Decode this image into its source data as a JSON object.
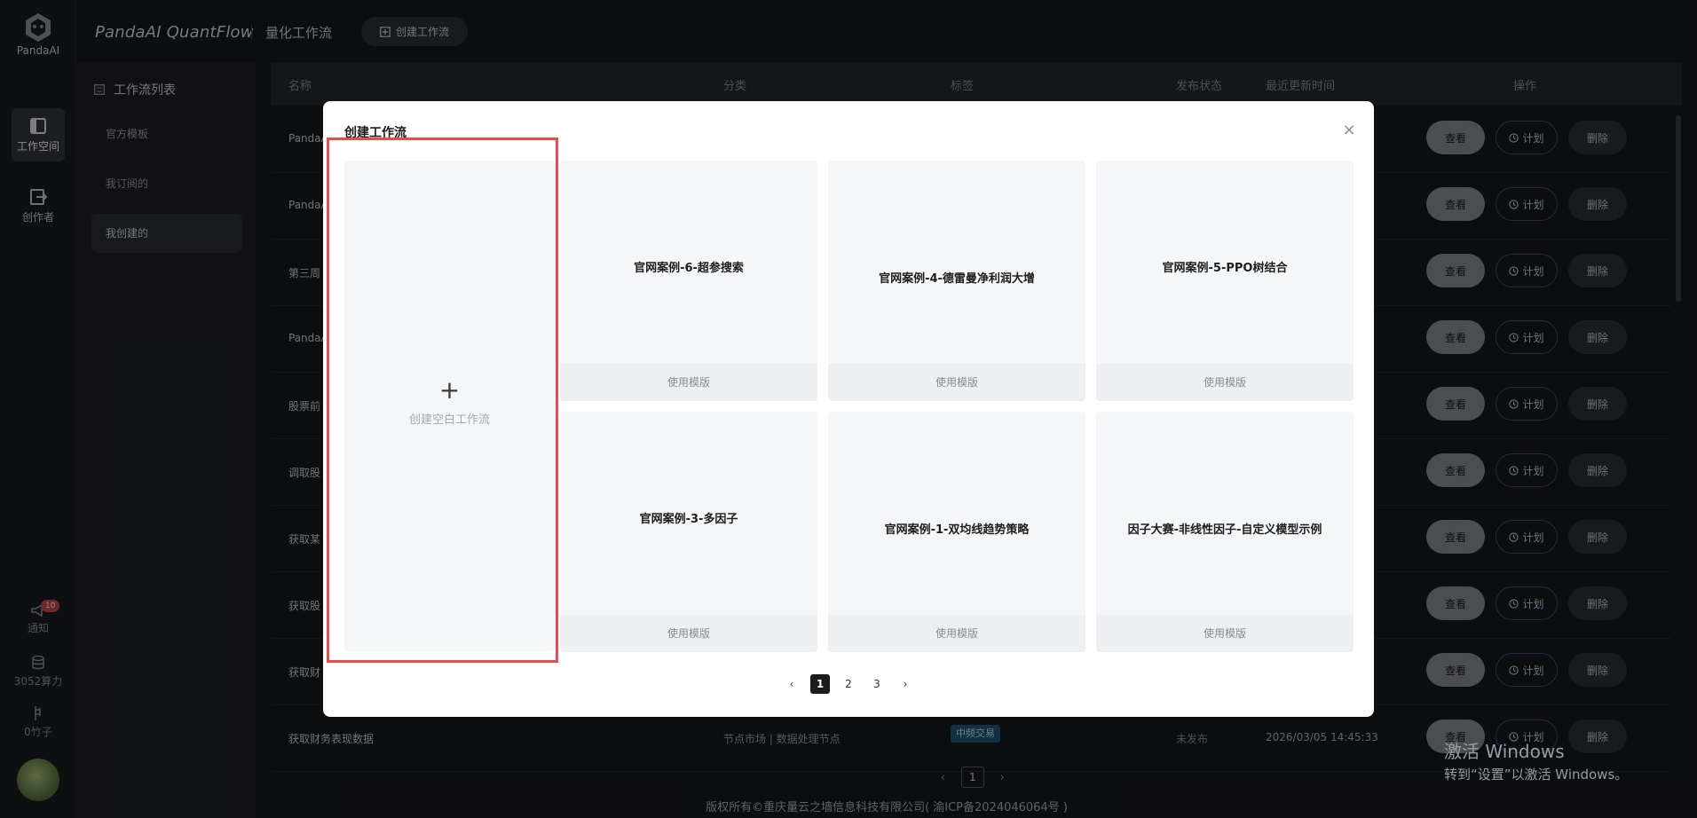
{
  "rail": {
    "logo_text": "PandaAI",
    "workspace_label": "工作空间",
    "creator_label": "创作者",
    "notify_label": "通知",
    "notify_badge": "10",
    "compute_label": "3052算力",
    "bamboo_label": "0竹子"
  },
  "header": {
    "app_title": "PandaAI QuantFlow",
    "app_subtitle": "量化工作流",
    "create_button": "创建工作流"
  },
  "sidebar": {
    "title": "工作流列表",
    "items": [
      {
        "label": "官方模板"
      },
      {
        "label": "我订阅的"
      },
      {
        "label": "我创建的"
      }
    ]
  },
  "table": {
    "columns": [
      "名称",
      "分类",
      "标签",
      "发布状态",
      "最近更新时间",
      "操作"
    ],
    "rows": [
      {
        "name": "PandaAI"
      },
      {
        "name": "PandaAI"
      },
      {
        "name": "第三周"
      },
      {
        "name": "PandaAI"
      },
      {
        "name": "股票前"
      },
      {
        "name": "调取股"
      },
      {
        "name": "获取某"
      },
      {
        "name": "获取股"
      },
      {
        "name": "获取财"
      },
      {
        "name": "获取财务表现数据",
        "category": "节点市场 | 数据处理节点",
        "tag": "中频交易",
        "status": "未发布",
        "time": "2026/03/05 14:45:33"
      }
    ],
    "actions": {
      "view": "查看",
      "plan": "计划",
      "delete": "删除"
    },
    "page": "1"
  },
  "footer": "版权所有©重庆量云之墙信息科技有限公司( 渝ICP备2024046064号 )",
  "watermark": {
    "line1": "激活 Windows",
    "line2": "转到“设置”以激活 Windows。"
  },
  "modal": {
    "title": "创建工作流",
    "close": "×",
    "blank": {
      "plus": "+",
      "label": "创建空白工作流"
    },
    "templates": [
      {
        "name": "官网案例-6-超参搜索",
        "use": "使用模版"
      },
      {
        "name": "官网案例-4-德雷曼净利润大增",
        "use": "使用模版"
      },
      {
        "name": "官网案例-5-PPO树结合",
        "use": "使用模版"
      },
      {
        "name": "官网案例-3-多因子",
        "use": "使用模版"
      },
      {
        "name": "官网案例-1-双均线趋势策略",
        "use": "使用模版"
      },
      {
        "name": "因子大赛-非线性因子-自定义模型示例",
        "use": "使用模版"
      }
    ],
    "pager": {
      "prev": "‹",
      "pages": [
        "1",
        "2",
        "3"
      ],
      "next": "›"
    }
  },
  "colors": {
    "accent_highlight": "#e84d4d",
    "plan_border": "#3b4e86",
    "tag_bg": "#205a78"
  }
}
